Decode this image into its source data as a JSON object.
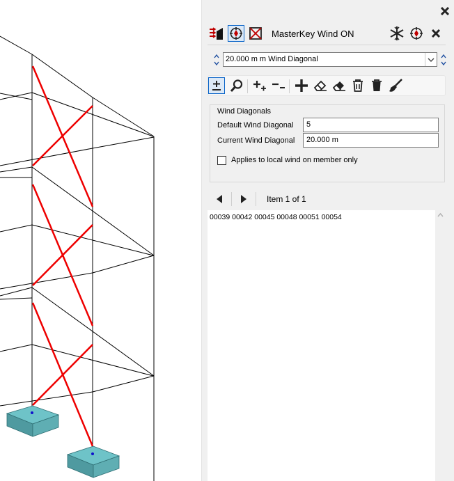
{
  "panel": {
    "title": "MasterKey Wind ON",
    "icons": {
      "wind_assign": "wind-diagonal-assign-icon",
      "target": "target-icon",
      "frame_x": "frame-cross-icon",
      "snowflake": "snowflake-icon",
      "target_right": "target-icon",
      "close": "close-icon"
    }
  },
  "combo": {
    "value": "20.000 m m Wind Diagonal"
  },
  "group": {
    "title": "Wind Diagonals",
    "default_label": "Default Wind Diagonal",
    "default_value": "5",
    "current_label": "Current Wind Diagonal",
    "current_value": "20.000 m",
    "checkbox_label": "Applies to local wind on member only",
    "checkbox_checked": false
  },
  "nav": {
    "item_text": "Item 1 of 1"
  },
  "list": {
    "text": "00039 00042 00045 00048 00051 00054"
  },
  "colors": {
    "bracing": "#ee0000",
    "footing": "#6ec3c8",
    "footing_side": "#4f9aa0",
    "node": "#1010cc",
    "frame": "#000000",
    "accent": "#0a64c8"
  }
}
